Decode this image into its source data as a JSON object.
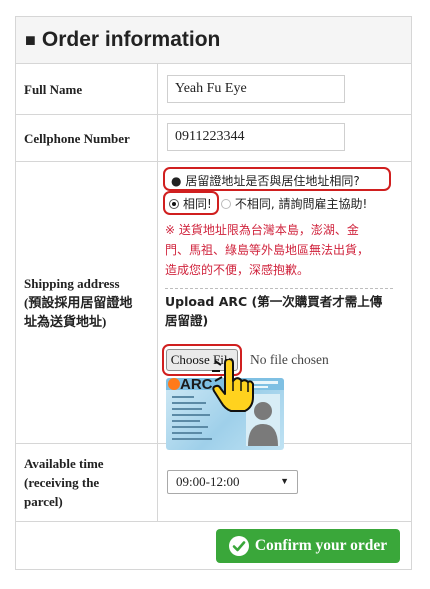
{
  "colors": {
    "accent_red": "#d01f1f",
    "warning_text": "#d0243d",
    "confirm_green": "#3aa73a"
  },
  "header": {
    "title": "Order information",
    "icon": "black-square-icon"
  },
  "fields": {
    "full_name": {
      "label": "Full Name",
      "value": "Yeah Fu Eye"
    },
    "cellphone": {
      "label": "Cellphone Number",
      "value": "0911223344"
    },
    "shipping": {
      "label_line1": "Shipping address",
      "label_line2": "(預設採用居留證地",
      "label_line3": "址為送貨地址)",
      "question": "居留證地址是否與居住地址相同?",
      "option_same": "相同!",
      "option_diff": "不相同, 請詢問雇主協助!",
      "warning_line1": "※ 送貨地址限為台灣本島，澎湖、金",
      "warning_line2": "門、馬祖、綠島等外島地區無法出貨，",
      "warning_line3": "造成您的不便，深感抱歉。",
      "upload_line1": "Upload ARC (第一次購買者才需上傳",
      "upload_line2": "居留證)",
      "choose_file": "Choose File",
      "no_file": "No file chosen",
      "arc_text": "ARC"
    },
    "available_time": {
      "label_line1": "Available time",
      "label_line2": "(receiving the",
      "label_line3": "parcel)",
      "selected": "09:00-12:00"
    }
  },
  "confirm_button": {
    "label": "Confirm your order",
    "icon": "check-circle-icon"
  }
}
